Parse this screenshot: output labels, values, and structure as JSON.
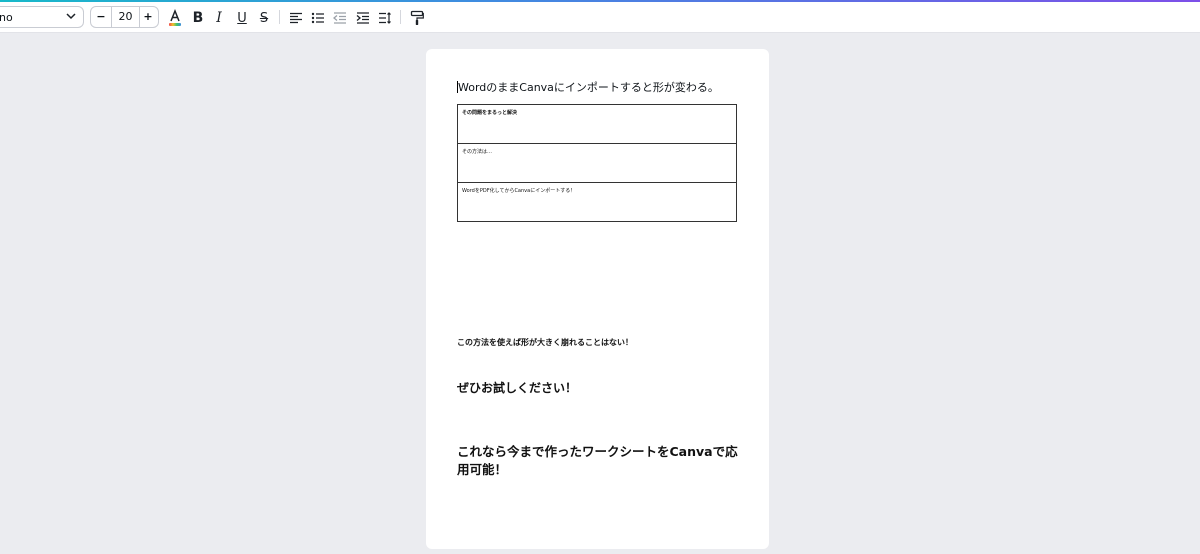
{
  "toolbar": {
    "font_value": "no",
    "font_size": "20",
    "decrease_label": "−",
    "increase_label": "+",
    "text_color_letter": "A",
    "bold_letter": "B",
    "italic_letter": "I",
    "underline_letter": "U",
    "strike_letter": "S",
    "icons": [
      "chevron-down-icon",
      "text-color-icon",
      "bold-icon",
      "italic-icon",
      "underline-icon",
      "strikethrough-icon",
      "align-left-icon",
      "bullet-list-icon",
      "outdent-icon",
      "indent-icon",
      "line-spacing-icon",
      "paint-roller-icon"
    ]
  },
  "document": {
    "title": "WordのままCanvaにインポートすると形が変わる。",
    "table_rows": [
      "その問題をまるっと解決",
      "その方法は…",
      "WordをPDF化してからCanvaにインポートする！"
    ],
    "para1": "この方法を使えば形が大きく崩れることはない！",
    "para2": "ぜひお試しください！",
    "para3": "これなら今まで作ったワークシートをCanvaで応用可能！"
  },
  "colors": {
    "background": "#ebecf0",
    "accent_start": "#18b9c9",
    "accent_end": "#7d4fe8"
  }
}
